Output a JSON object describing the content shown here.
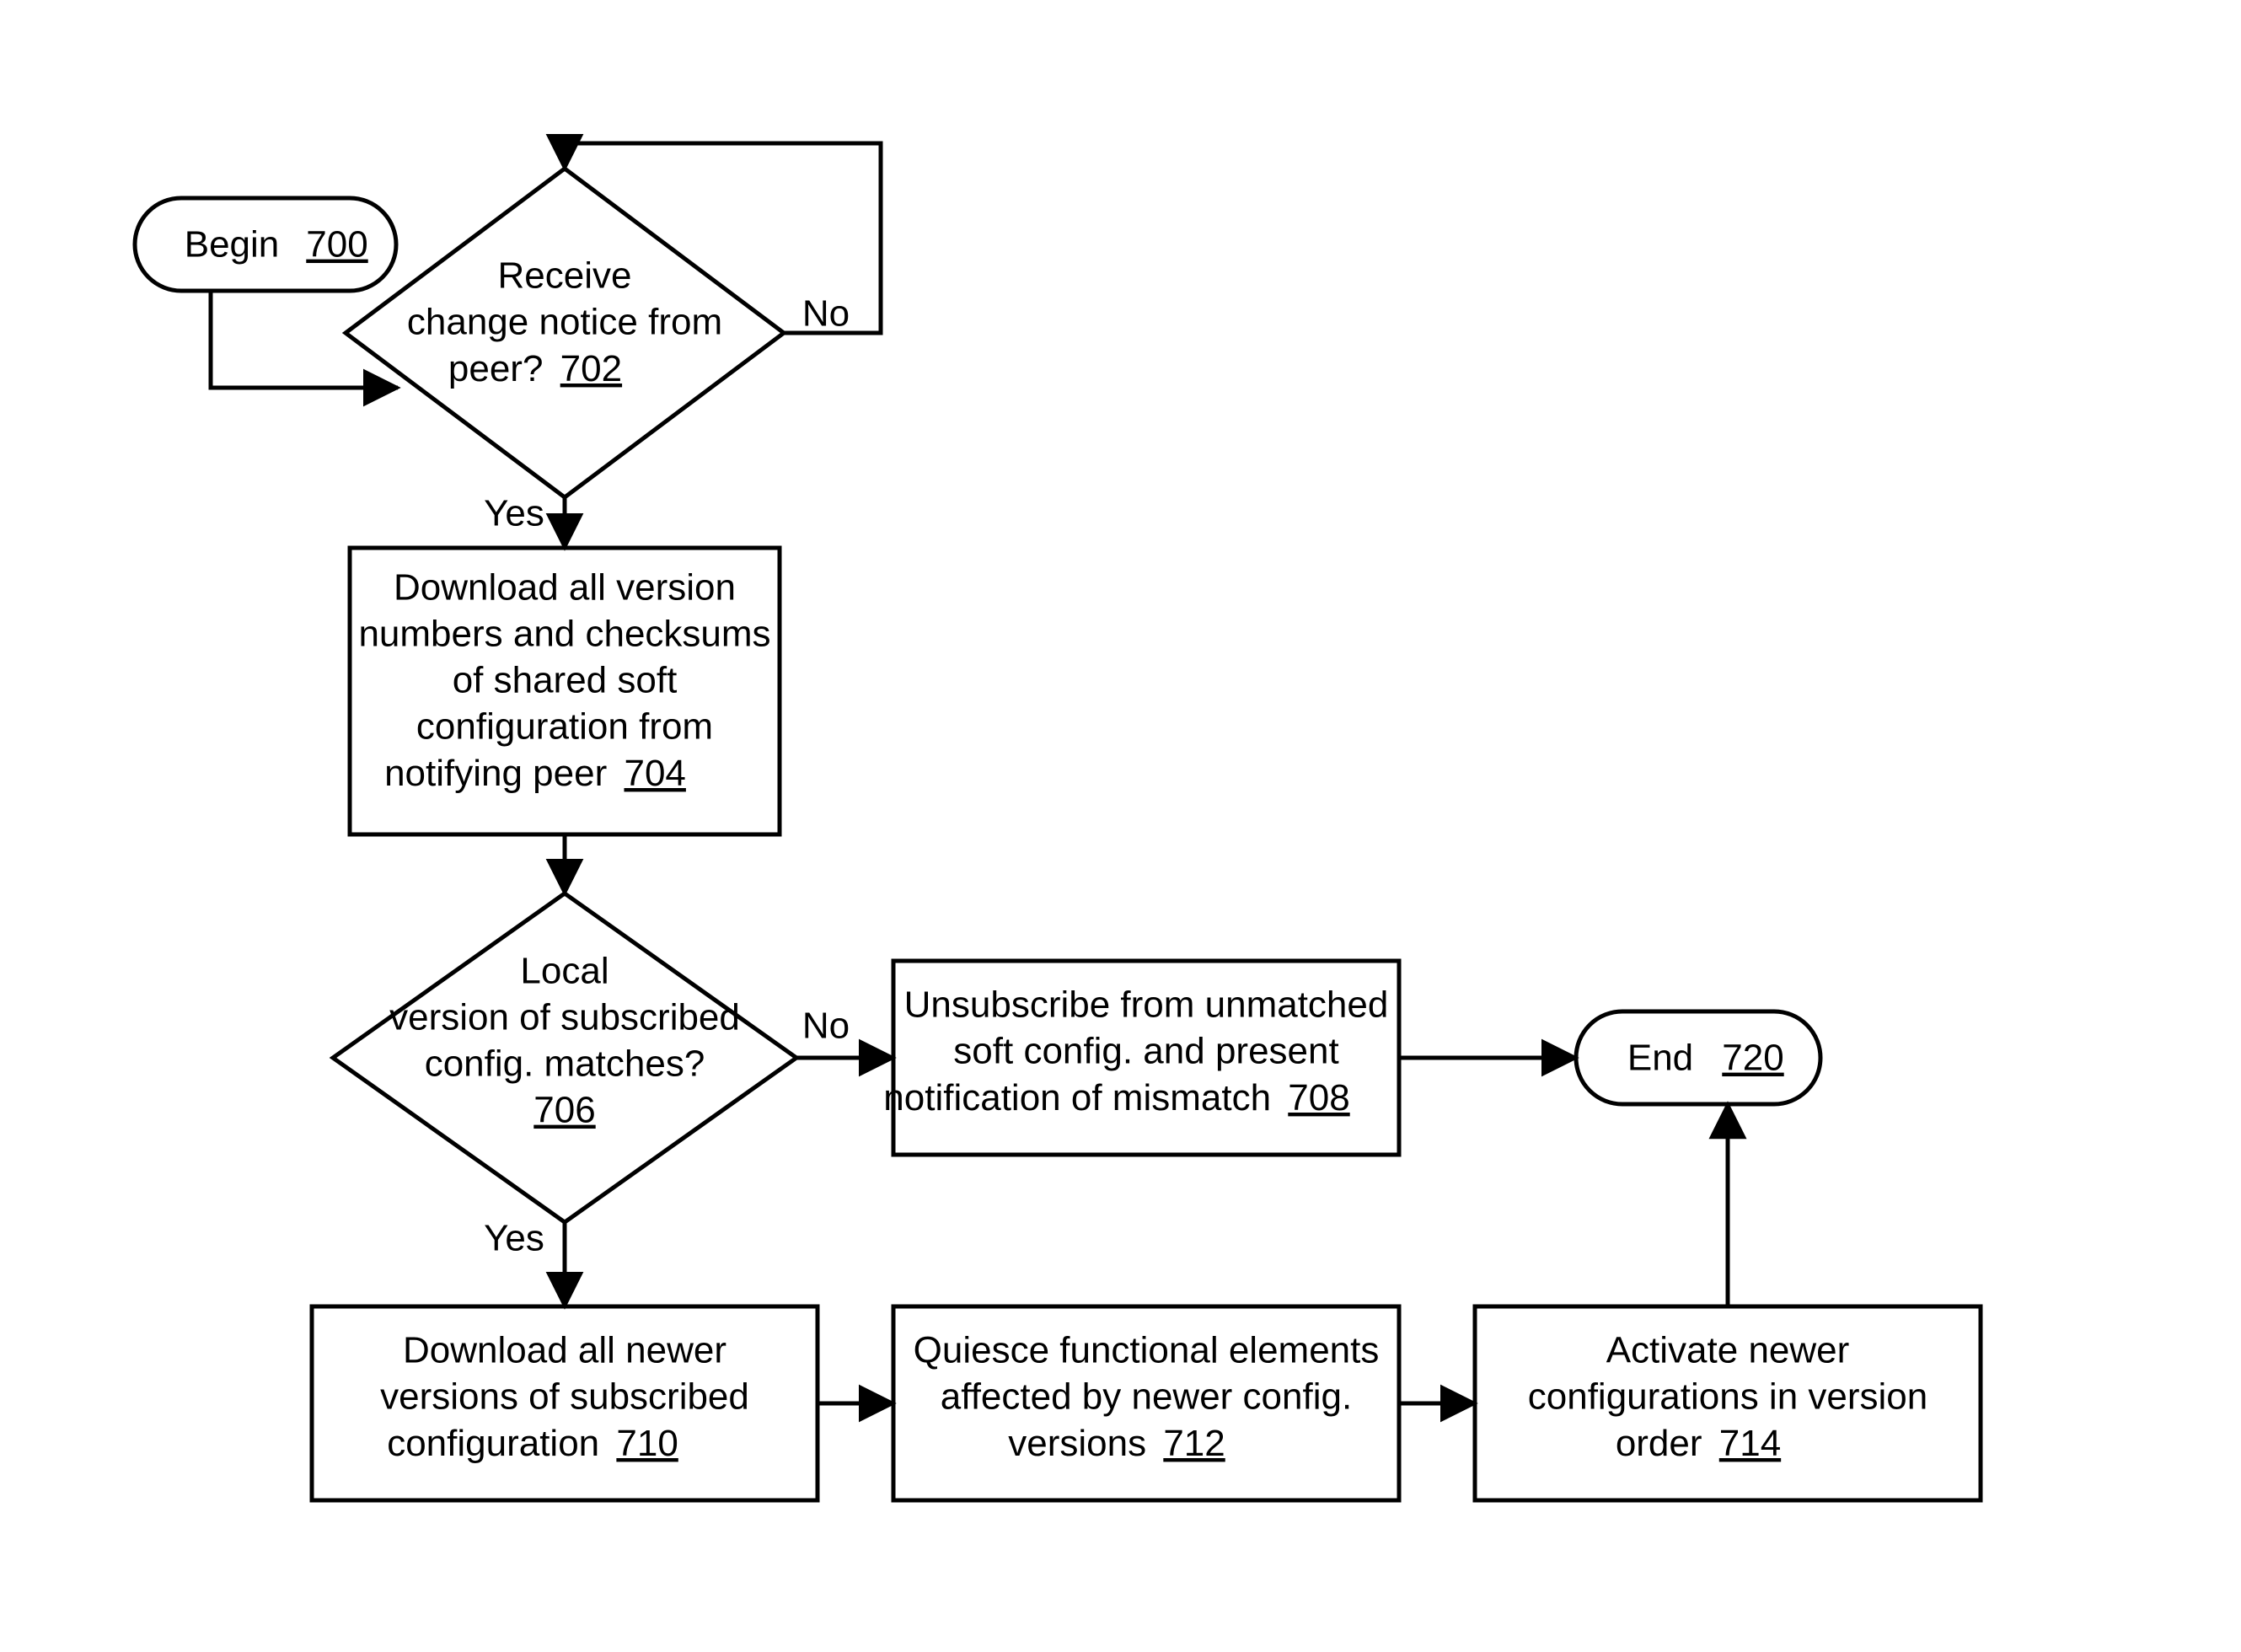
{
  "nodes": {
    "begin": {
      "label": "Begin",
      "ref": "700"
    },
    "end": {
      "label": "End",
      "ref": "720"
    },
    "dec702": {
      "line1": "Receive",
      "line2": "change notice from",
      "line3": "peer?",
      "ref": "702"
    },
    "proc704": {
      "line1": "Download all version",
      "line2": "numbers and checksums",
      "line3": "of shared soft",
      "line4": "configuration from",
      "line5": "notifying peer",
      "ref": "704"
    },
    "dec706": {
      "line1": "Local",
      "line2": "version of subscribed",
      "line3": "config. matches?",
      "ref": "706"
    },
    "proc708": {
      "line1": "Unsubscribe from unmatched",
      "line2": "soft config. and present",
      "line3": "notification of mismatch",
      "ref": "708"
    },
    "proc710": {
      "line1": "Download all newer",
      "line2": "versions of subscribed",
      "line3": "configuration",
      "ref": "710"
    },
    "proc712": {
      "line1": "Quiesce functional elements",
      "line2": "affected by newer config.",
      "line3": "versions",
      "ref": "712"
    },
    "proc714": {
      "line1": "Activate newer",
      "line2": "configurations in version",
      "line3": "order",
      "ref": "714"
    }
  },
  "edges": {
    "yes": "Yes",
    "no": "No"
  }
}
